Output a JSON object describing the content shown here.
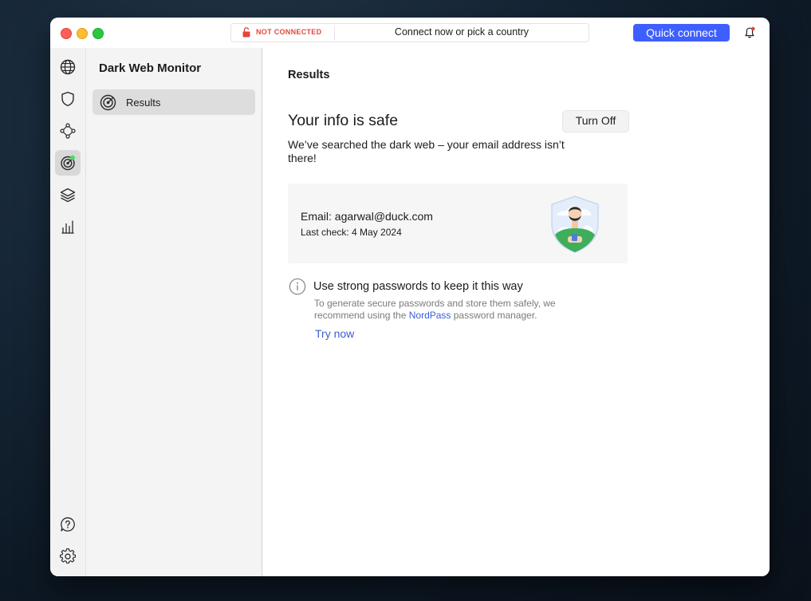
{
  "titlebar": {
    "status": "NOT CONNECTED",
    "connect_prompt": "Connect now or pick a country",
    "quick_connect": "Quick connect"
  },
  "rail": {
    "top_icons": [
      "globe-icon",
      "shield-icon",
      "meshnet-icon",
      "dark-web-monitor-icon",
      "layers-icon",
      "stats-icon"
    ],
    "bottom_icons": [
      "help-icon",
      "settings-icon"
    ],
    "active": "dark-web-monitor-icon"
  },
  "sidebar": {
    "title": "Dark Web Monitor",
    "items": [
      {
        "label": "Results",
        "icon": "radar-icon"
      }
    ]
  },
  "main": {
    "title": "Results",
    "heading": "Your info is safe",
    "turn_off": "Turn Off",
    "description": "We’ve searched the dark web – your email address isn’t there!",
    "card": {
      "email": "Email: agarwal@duck.com",
      "last_check": "Last check: 4 May 2024"
    },
    "tip": {
      "heading": "Use strong passwords to keep it this way",
      "desc_before": "To generate secure passwords and store them safely, we recommend using the ",
      "link": "NordPass",
      "desc_after": " password manager.",
      "action": "Try now"
    }
  },
  "colors": {
    "accent": "#3e5fff",
    "link": "#3b5cd6",
    "danger": "#e2473b",
    "online_dot": "#4cd964"
  }
}
